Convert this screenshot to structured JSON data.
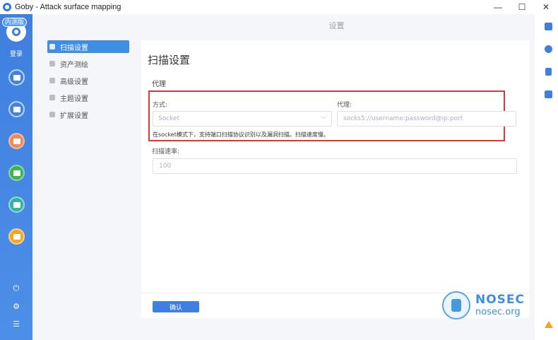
{
  "window": {
    "title": "Goby - Attack surface mapping",
    "controls": {
      "minimize": "—",
      "maximize": "☐",
      "close": "✕"
    }
  },
  "sidebar": {
    "beta_badge": "内测版",
    "login": "登录",
    "nav_icons": [
      "scan-icon",
      "asset-icon",
      "vulnerability-icon",
      "report-icon",
      "plugin-icon",
      "extension-icon"
    ],
    "bottom_icons": [
      "power-icon",
      "settings-icon",
      "menu-icon"
    ]
  },
  "settings_nav": {
    "items": [
      {
        "label": "扫描设置",
        "active": true
      },
      {
        "label": "资产测绘",
        "active": false
      },
      {
        "label": "高级设置",
        "active": false
      },
      {
        "label": "主题设置",
        "active": false
      },
      {
        "label": "扩展设置",
        "active": false
      }
    ]
  },
  "main": {
    "header": "设置",
    "card_title": "扫描设置",
    "proxy_section": "代理",
    "mode_label": "方式:",
    "mode_value": "Socket",
    "proxy_label": "代理:",
    "proxy_placeholder": "socks5://username:password@ip:port",
    "hint": "在socket模式下，支持端口扫描协议识别以及漏洞扫描。扫描速度慢。",
    "rate_label": "扫描速率:",
    "rate_value": "100",
    "confirm": "确认"
  },
  "watermark": {
    "brand": "NOSEC",
    "domain": "nosec.org"
  },
  "right_rail": {
    "icons": [
      "task-list-icon",
      "clock-icon",
      "document-icon",
      "grid-icon"
    ],
    "alert_icon": "warning-icon"
  },
  "colors": {
    "accent": "#3f7fdf",
    "highlight_border": "#e0353b",
    "warning": "#f3a51b"
  }
}
